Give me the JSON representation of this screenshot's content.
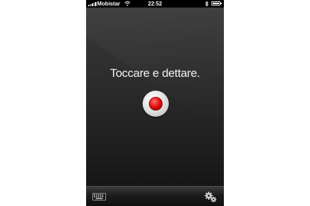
{
  "status_bar": {
    "carrier": "Mobistar",
    "time": "22:52",
    "signal_bars": 5
  },
  "main": {
    "prompt": "Toccare e dettare."
  },
  "icons": {
    "wifi": "wifi-icon",
    "bluetooth": "bluetooth-icon",
    "battery": "battery-icon",
    "record": "record-icon",
    "keyboard": "keyboard-icon",
    "settings": "gears-icon"
  },
  "colors": {
    "record_red": "#e01010",
    "background": "#222222"
  }
}
